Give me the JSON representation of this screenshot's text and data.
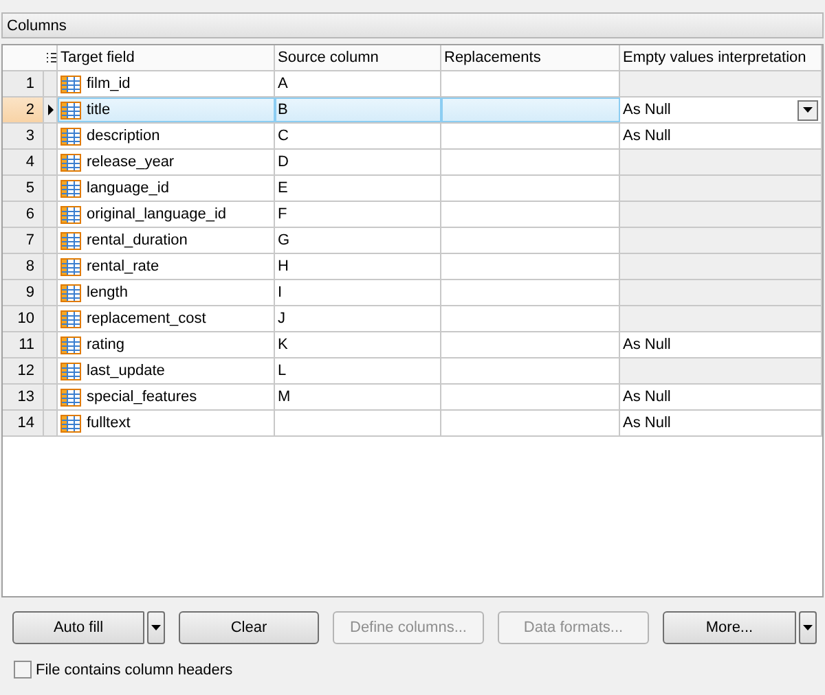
{
  "section_title": "Columns",
  "table": {
    "columns": [
      "Target field",
      "Source column",
      "Replacements",
      "Empty values interpretation"
    ],
    "rows": [
      {
        "number": "1",
        "field": "film_id",
        "source": "A",
        "replacement": "",
        "empty": "",
        "selected": false
      },
      {
        "number": "2",
        "field": "title",
        "source": "B",
        "replacement": "",
        "empty": "As Null",
        "selected": true
      },
      {
        "number": "3",
        "field": "description",
        "source": "C",
        "replacement": "",
        "empty": "As Null",
        "selected": false
      },
      {
        "number": "4",
        "field": "release_year",
        "source": "D",
        "replacement": "",
        "empty": "",
        "selected": false
      },
      {
        "number": "5",
        "field": "language_id",
        "source": "E",
        "replacement": "",
        "empty": "",
        "selected": false
      },
      {
        "number": "6",
        "field": "original_language_id",
        "source": "F",
        "replacement": "",
        "empty": "",
        "selected": false
      },
      {
        "number": "7",
        "field": "rental_duration",
        "source": "G",
        "replacement": "",
        "empty": "",
        "selected": false
      },
      {
        "number": "8",
        "field": "rental_rate",
        "source": "H",
        "replacement": "",
        "empty": "",
        "selected": false
      },
      {
        "number": "9",
        "field": "length",
        "source": "I",
        "replacement": "",
        "empty": "",
        "selected": false
      },
      {
        "number": "10",
        "field": "replacement_cost",
        "source": "J",
        "replacement": "",
        "empty": "",
        "selected": false
      },
      {
        "number": "11",
        "field": "rating",
        "source": "K",
        "replacement": "",
        "empty": "As Null",
        "selected": false
      },
      {
        "number": "12",
        "field": "last_update",
        "source": "L",
        "replacement": "",
        "empty": "",
        "selected": false
      },
      {
        "number": "13",
        "field": "special_features",
        "source": "M",
        "replacement": "",
        "empty": "As Null",
        "selected": false
      },
      {
        "number": "14",
        "field": "fulltext",
        "source": "",
        "replacement": "",
        "empty": "As Null",
        "selected": false
      }
    ]
  },
  "buttons": [
    {
      "label": "Auto fill",
      "disabled": false,
      "dropdown": true
    },
    {
      "label": "Clear",
      "disabled": false,
      "dropdown": false
    },
    {
      "label": "Define columns...",
      "disabled": true,
      "dropdown": false
    },
    {
      "label": "Data formats...",
      "disabled": true,
      "dropdown": false
    },
    {
      "label": "More...",
      "disabled": false,
      "dropdown": true
    }
  ],
  "header_checkbox": {
    "label": "File contains column headers",
    "checked": false
  }
}
